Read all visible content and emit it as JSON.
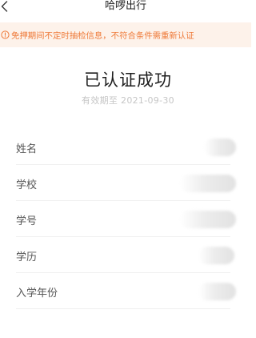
{
  "nav": {
    "title": "哈啰出行"
  },
  "notice": {
    "text": "免押期间不定时抽检信息，不符合条件需重新认证"
  },
  "status": {
    "title": "已认证成功",
    "validity": "有效期至 2021-09-30"
  },
  "info": {
    "rows": [
      {
        "label": "姓名",
        "value": ""
      },
      {
        "label": "学校",
        "value": ""
      },
      {
        "label": "学号",
        "value": ""
      },
      {
        "label": "学历",
        "value": ""
      },
      {
        "label": "入学年份",
        "value": ""
      }
    ]
  },
  "colors": {
    "notice_bg": "#fdf2ea",
    "notice_text": "#ee7a39"
  },
  "icons": {
    "back": "chevron-left-icon",
    "notice": "info-circle-icon"
  }
}
